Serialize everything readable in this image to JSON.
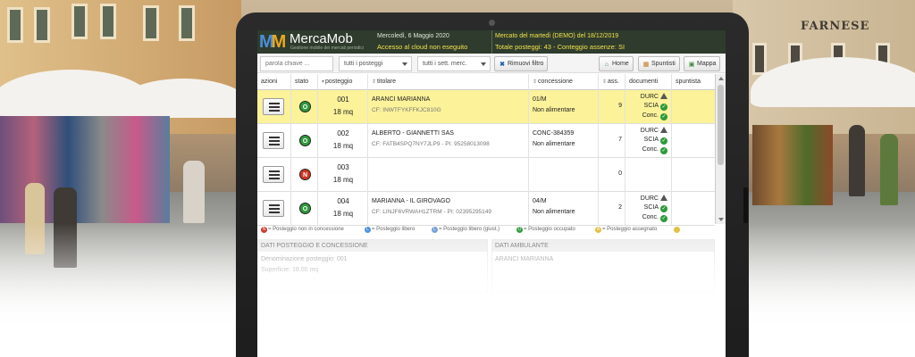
{
  "app": {
    "name": "MercaMob",
    "subtitle": "Gestione mobile dei mercati periodici"
  },
  "header": {
    "date": "Mercoledì, 6 Maggio 2020",
    "cloud_status": "Accesso al cloud non eseguito",
    "market": "Mercato del martedì (DEMO) del 18/12/2019",
    "totals": "Totale posteggi: 43 - Conteggio assenze: SI"
  },
  "toolbar": {
    "search_placeholder": "parola chiave ...",
    "filter_posteggi": "tutti i posteggi",
    "filter_settori": "tutti i sett. merc.",
    "remove_filter": "Rimuovi filtro",
    "home": "Home",
    "spuntisti": "Spuntisti",
    "mappa": "Mappa"
  },
  "table": {
    "columns": {
      "azioni": "azioni",
      "stato": "stato",
      "posteggio": "posteggio",
      "titolare": "titolare",
      "concessione": "concessione",
      "ass": "ass.",
      "documenti": "documenti",
      "spuntista": "spuntista"
    },
    "rows": [
      {
        "stato": "O",
        "numero": "001",
        "area": "18 mq",
        "titolare": "ARANCI MARIANNA",
        "codici": "CF: INWTFYKFFKJC810G",
        "concessione": "01/M",
        "tipo": "Non alimentare",
        "assenze": "9",
        "doc1": "DURC",
        "doc2": "SCIA",
        "doc3": "Conc."
      },
      {
        "stato": "O",
        "numero": "002",
        "area": "18 mq",
        "titolare": "ALBERTO - GIANNETTI SAS",
        "codici": "CF: FATB4SPQ7NY7JLP9 - PI: 95258013098",
        "concessione": "CONC-384359",
        "tipo": "Non alimentare",
        "assenze": "7",
        "doc1": "DURC",
        "doc2": "SCIA",
        "doc3": "Conc."
      },
      {
        "stato": "N",
        "numero": "003",
        "area": "18 mq",
        "titolare": "",
        "codici": "",
        "concessione": "",
        "tipo": "",
        "assenze": "0",
        "doc1": "",
        "doc2": "",
        "doc3": ""
      },
      {
        "stato": "O",
        "numero": "004",
        "area": "18 mq",
        "titolare": "MARIANNA - IL GIROVAGO",
        "codici": "CF: LINJF6VRWAH1ZTRM - PI: 02395295149",
        "concessione": "04/M",
        "tipo": "Non alimentare",
        "assenze": "2",
        "doc1": "DURC",
        "doc2": "SCIA",
        "doc3": "Conc."
      }
    ]
  },
  "legend": {
    "n": "= Posteggio non in concessione",
    "l": "= Posteggio libero",
    "lg": "= Posteggio libero (giust.)",
    "o": "= Posteggio occupato",
    "a": "= Posteggio assegnato"
  },
  "panels": {
    "left_title": "DATI POSTEGGIO E CONCESSIONE",
    "left_line1": "Denominazione posteggio: 001",
    "left_line2": "Superficie: 18.00 mq",
    "right_title": "DATI AMBULANTE",
    "right_line1": "ARANCI MARIANNA"
  },
  "colors": {
    "header_bg": "#2f3b2d",
    "highlight_row": "#fbf29a",
    "status_occupied": "#2e9a3a",
    "status_not_conc": "#d03424",
    "logo_m1": "#4c8fd8",
    "logo_m2": "#e9a81f"
  },
  "icons": {
    "menu": "hamburger-icon",
    "remove_filter": "close-icon",
    "home": "home-icon",
    "spuntisti": "calendar-icon",
    "mappa": "map-icon",
    "doc_warning": "warning-icon",
    "doc_ok": "check-icon"
  }
}
